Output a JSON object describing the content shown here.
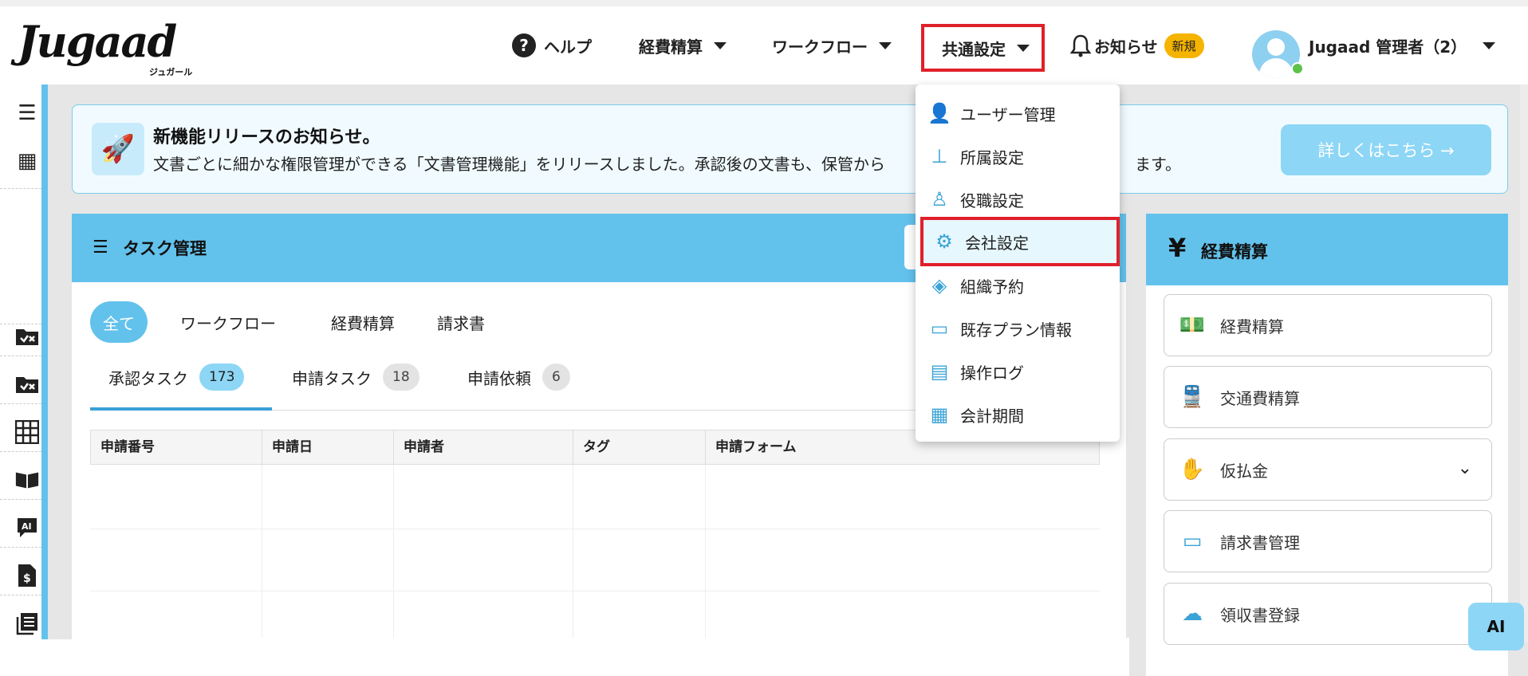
{
  "header": {
    "logo_text": "Jugaad",
    "logo_sub": "ジュガール",
    "help_label": "ヘルプ",
    "nav_expense": "経費精算",
    "nav_workflow": "ワークフロー",
    "nav_common": "共通設定",
    "notice_label": "お知らせ",
    "notice_badge": "新規",
    "user_name": "Jugaad 管理者（2）"
  },
  "banner": {
    "title": "新機能リリースのお知らせ。",
    "text": "文書ごとに細かな権限管理ができる「文書管理機能」をリリースしました。承認後の文書も、保管から",
    "text_tail": "ます。",
    "button_label": "詳しくはこちら →"
  },
  "dropdown": {
    "items": [
      {
        "label": "ユーザー管理",
        "icon": "user-plus-icon"
      },
      {
        "label": "所属設定",
        "icon": "org-chart-icon"
      },
      {
        "label": "役職設定",
        "icon": "person-pin-icon"
      },
      {
        "label": "会社設定",
        "icon": "gear-icon"
      },
      {
        "label": "組織予約",
        "icon": "layers-icon"
      },
      {
        "label": "既存プラン情報",
        "icon": "card-icon"
      },
      {
        "label": "操作ログ",
        "icon": "archive-icon"
      },
      {
        "label": "会計期間",
        "icon": "calendar-icon"
      }
    ]
  },
  "task": {
    "title": "タスク管理",
    "filters": [
      "全て",
      "ワークフロー",
      "経費精算",
      "請求書"
    ],
    "tabs": [
      {
        "label": "承認タスク",
        "count": "173"
      },
      {
        "label": "申請タスク",
        "count": "18"
      },
      {
        "label": "申請依頼",
        "count": "6"
      }
    ],
    "columns": [
      "申請番号",
      "申請日",
      "申請者",
      "タグ",
      "申請フォーム"
    ]
  },
  "expense_panel": {
    "title": "経費精算",
    "yen": "¥",
    "items": [
      {
        "label": "経費精算",
        "icon": "money-icon"
      },
      {
        "label": "交通費精算",
        "icon": "train-icon"
      },
      {
        "label": "仮払金",
        "icon": "hand-money-icon"
      },
      {
        "label": "請求書管理",
        "icon": "card-icon"
      },
      {
        "label": "領収書登録",
        "icon": "cloud-upload-icon"
      }
    ]
  },
  "ai_label": "AI",
  "colors": {
    "accent": "#63c2ec",
    "highlight_border": "#e0202a",
    "badge": "#f5b400"
  }
}
